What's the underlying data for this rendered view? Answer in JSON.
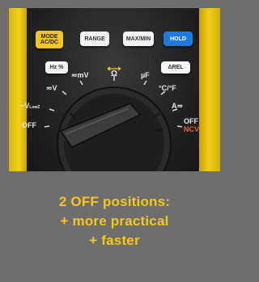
{
  "buttons": {
    "mode_line1": "MODE",
    "mode_line2": "AC/DC",
    "range": "RANGE",
    "maxmin": "MAX/MIN",
    "hold": "HOLD",
    "hz": "Hz %",
    "rel": "ΔREL"
  },
  "dial_labels": {
    "off_left": "OFF",
    "v_low": "~V",
    "v_low_sub": "LowZ",
    "v_ac": "≂V",
    "mv": "≂mV",
    "ohm": "Ω",
    "uf": "µF",
    "temp": "°C/°F",
    "amp": "A≂",
    "off_right": "OFF",
    "ncv": "NCV"
  },
  "caption": {
    "line1": "2 OFF positions:",
    "line2": "+ more practical",
    "line3": "+ faster"
  },
  "colors": {
    "background": "#6e6e6c",
    "caption": "#f6c71a",
    "meter_yellow": "#f2cf1a",
    "hold_blue": "#1e7ae0",
    "ncv_orange": "#e8651a"
  }
}
